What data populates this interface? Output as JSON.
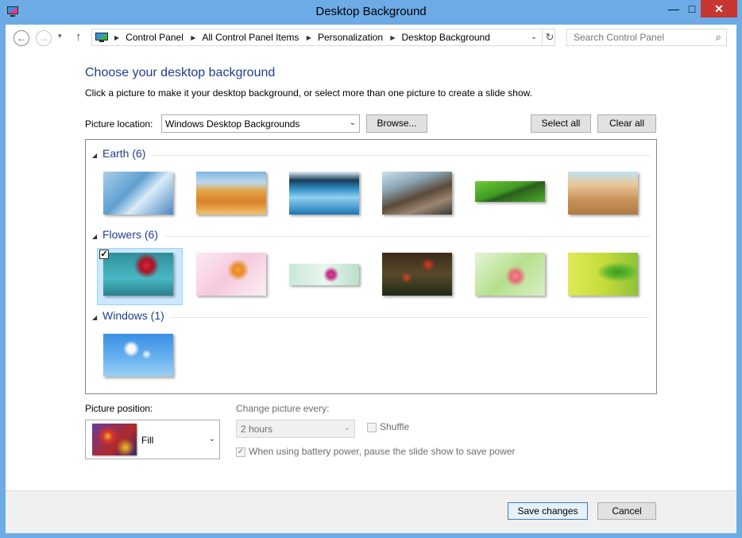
{
  "window": {
    "title": "Desktop Background",
    "controls": {
      "minimize": "—",
      "maximize": "□",
      "close": "✕"
    }
  },
  "nav": {
    "back": "←",
    "forward": "→",
    "recent": "▾",
    "up": "↑",
    "breadcrumbs": [
      "Control Panel",
      "All Control Panel Items",
      "Personalization",
      "Desktop Background"
    ],
    "refresh": "↻",
    "dropdown": "⌄"
  },
  "search": {
    "placeholder": "Search Control Panel",
    "icon": "⌕"
  },
  "heading": "Choose your desktop background",
  "instructions": "Click a picture to make it your desktop background, or select more than one picture to create a slide show.",
  "picture_location": {
    "label": "Picture location:",
    "value": "Windows Desktop Backgrounds",
    "browse": "Browse...",
    "select_all": "Select all",
    "clear_all": "Clear all"
  },
  "groups": [
    {
      "title": "Earth (6)"
    },
    {
      "title": "Flowers (6)"
    },
    {
      "title": "Windows (1)"
    }
  ],
  "picture_position": {
    "label": "Picture position:",
    "value": "Fill"
  },
  "slideshow": {
    "label": "Change picture every:",
    "interval": "2 hours",
    "shuffle_label": "Shuffle",
    "battery_label": "When using battery power, pause the slide show to save power"
  },
  "footer": {
    "save": "Save changes",
    "cancel": "Cancel"
  },
  "colors": {
    "heading": "#1e3f8c",
    "selection": "#cce8ff",
    "frame": "#6cabe6",
    "close": "#c7372f"
  }
}
